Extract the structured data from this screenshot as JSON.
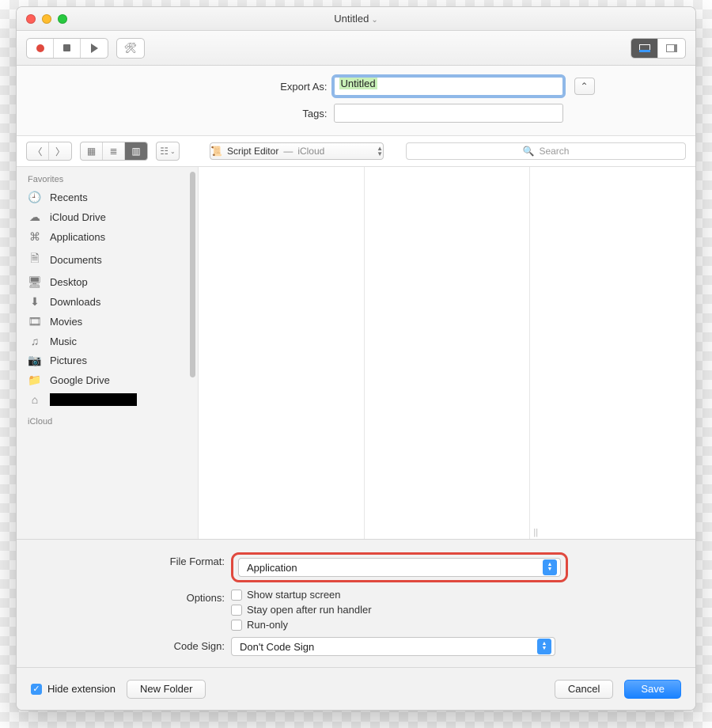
{
  "window": {
    "title": "Untitled"
  },
  "export": {
    "export_as_label": "Export As:",
    "export_as_value": "Untitled",
    "tags_label": "Tags:",
    "tags_value": ""
  },
  "location": {
    "app": "Script Editor",
    "place": "iCloud"
  },
  "search": {
    "placeholder": "Search"
  },
  "sidebar": {
    "heading_fav": "Favorites",
    "heading_icloud": "iCloud",
    "items": [
      {
        "icon": "🕘",
        "label": "Recents"
      },
      {
        "icon": "☁",
        "label": "iCloud Drive"
      },
      {
        "icon": "⌘",
        "label": "Applications"
      },
      {
        "icon": "🗎",
        "label": "Documents"
      },
      {
        "icon": "🖥",
        "label": "Desktop"
      },
      {
        "icon": "⬇",
        "label": "Downloads"
      },
      {
        "icon": "🎞",
        "label": "Movies"
      },
      {
        "icon": "♫",
        "label": "Music"
      },
      {
        "icon": "📷",
        "label": "Pictures"
      },
      {
        "icon": "📁",
        "label": "Google Drive"
      },
      {
        "icon": "⌂",
        "label": ""
      }
    ]
  },
  "form": {
    "file_format_label": "File Format:",
    "file_format_value": "Application",
    "options_label": "Options:",
    "options": [
      "Show startup screen",
      "Stay open after run handler",
      "Run-only"
    ],
    "code_sign_label": "Code Sign:",
    "code_sign_value": "Don't Code Sign"
  },
  "footer": {
    "hide_ext": "Hide extension",
    "new_folder": "New Folder",
    "cancel": "Cancel",
    "save": "Save"
  }
}
